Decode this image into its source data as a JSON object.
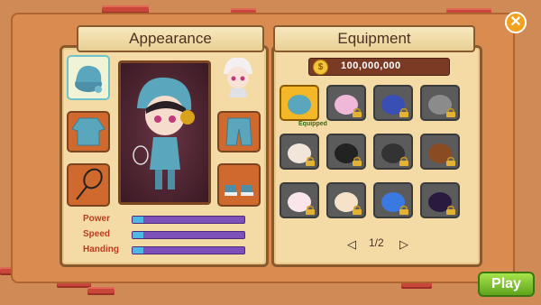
{
  "appearance": {
    "title": "Appearance"
  },
  "equipment": {
    "title": "Equipment",
    "gold": "100,000,000",
    "equipped_label": "Equipped",
    "page": "1/2",
    "items": [
      {
        "icon": "hat-icon",
        "locked": false,
        "equipped": true
      },
      {
        "icon": "pink-helmet-icon",
        "locked": true
      },
      {
        "icon": "police-cap-icon",
        "locked": true
      },
      {
        "icon": "cat-hat-icon",
        "locked": true
      },
      {
        "icon": "sheep-hat-icon",
        "locked": true
      },
      {
        "icon": "black-feather-hat-icon",
        "locked": true
      },
      {
        "icon": "black-cap-icon",
        "locked": true
      },
      {
        "icon": "bear-hat-icon",
        "locked": true
      },
      {
        "icon": "bunny-hat-icon",
        "locked": true
      },
      {
        "icon": "white-cap-icon",
        "locked": true
      },
      {
        "icon": "blue-crystal-icon",
        "locked": true
      },
      {
        "icon": "top-hat-icon",
        "locked": true
      }
    ]
  },
  "stats": [
    {
      "label": "Power",
      "value": 0.1
    },
    {
      "label": "Speed",
      "value": 0.1
    },
    {
      "label": "Handing",
      "value": 0.1
    }
  ],
  "buttons": {
    "play": "Play",
    "close": "✕"
  },
  "colors": {
    "accent": "#f2a21f",
    "play": "#6fb622",
    "stat_bar": "#7c4fb9",
    "stat_fill": "#4fb7e4"
  }
}
